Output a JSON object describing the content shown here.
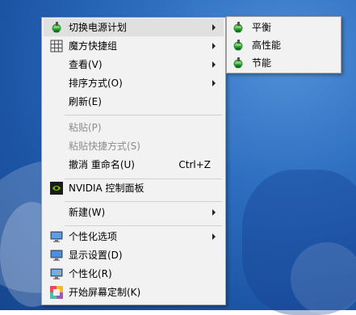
{
  "menu": {
    "items": [
      {
        "label": "切换电源计划",
        "icon": "power-plan-icon",
        "submenu": true,
        "highlight": true
      },
      {
        "label": "魔方快捷组",
        "icon": "grid-icon",
        "submenu": true
      },
      {
        "label": "查看(V)",
        "submenu": true
      },
      {
        "label": "排序方式(O)",
        "submenu": true
      },
      {
        "label": "刷新(E)"
      },
      {
        "label": "粘贴(P)",
        "disabled": true
      },
      {
        "label": "粘贴快捷方式(S)",
        "disabled": true
      },
      {
        "label": "撤消 重命名(U)",
        "shortcut": "Ctrl+Z"
      },
      {
        "label": "NVIDIA 控制面板",
        "icon": "nvidia-icon"
      },
      {
        "label": "新建(W)",
        "submenu": true
      },
      {
        "label": "个性化选项",
        "icon": "monitor-icon",
        "submenu": true
      },
      {
        "label": "显示设置(D)",
        "icon": "display-settings-icon"
      },
      {
        "label": "个性化(R)",
        "icon": "personalize-icon"
      },
      {
        "label": "开始屏幕定制(K)",
        "icon": "start-screen-icon"
      }
    ]
  },
  "submenu": {
    "items": [
      {
        "label": "平衡",
        "icon": "power-plan-icon"
      },
      {
        "label": "高性能",
        "icon": "power-plan-icon"
      },
      {
        "label": "节能",
        "icon": "power-plan-icon"
      }
    ]
  },
  "colors": {
    "menu_bg": "#f2f2f2",
    "highlight": "#e0e0e0",
    "disabled_text": "#8d8d8d",
    "desktop": "#2e6fc0"
  }
}
